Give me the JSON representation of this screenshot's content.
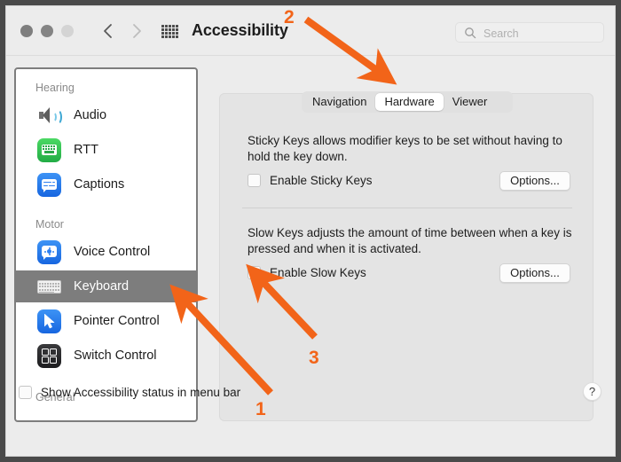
{
  "window": {
    "title": "Accessibility",
    "traffic_lights": [
      "close",
      "minimize",
      "zoom"
    ],
    "nav_back_label": "Back",
    "nav_forward_label": "Forward",
    "grid_label": "Show All"
  },
  "search": {
    "placeholder": "Search",
    "value": ""
  },
  "sidebar": {
    "groups": [
      {
        "label": "Hearing"
      },
      {
        "label": "Motor"
      },
      {
        "label": "General"
      }
    ],
    "items": [
      {
        "label": "Audio",
        "icon": "audio-icon",
        "selected": false
      },
      {
        "label": "RTT",
        "icon": "rtt-icon",
        "selected": false
      },
      {
        "label": "Captions",
        "icon": "captions-icon",
        "selected": false
      },
      {
        "label": "Voice Control",
        "icon": "voice-control-icon",
        "selected": false
      },
      {
        "label": "Keyboard",
        "icon": "keyboard-icon",
        "selected": true
      },
      {
        "label": "Pointer Control",
        "icon": "pointer-control-icon",
        "selected": false
      },
      {
        "label": "Switch Control",
        "icon": "switch-control-icon",
        "selected": false
      }
    ]
  },
  "main": {
    "tabs": [
      {
        "label": "Navigation",
        "active": false
      },
      {
        "label": "Hardware",
        "active": true
      },
      {
        "label": "Viewer",
        "active": false
      }
    ],
    "sections": [
      {
        "description": "Sticky Keys allows modifier keys to be set without having to hold the key down.",
        "checkbox_label": "Enable Sticky Keys",
        "checked": false,
        "options_label": "Options..."
      },
      {
        "description": "Slow Keys adjusts the amount of time between when a key is pressed and when it is activated.",
        "checkbox_label": "Enable Slow Keys",
        "checked": false,
        "options_label": "Options..."
      }
    ]
  },
  "footer": {
    "checkbox_label": "Show Accessibility status in menu bar",
    "checked": false,
    "help_label": "?"
  },
  "annotations": {
    "accent_color": "#f26419",
    "markers": [
      {
        "number": "1",
        "target": "sidebar-item-keyboard"
      },
      {
        "number": "2",
        "target": "tab-hardware"
      },
      {
        "number": "3",
        "target": "enable-slow-keys-checkbox"
      }
    ]
  },
  "colors": {
    "window_bg": "#ececec",
    "panel_bg": "#e4e4e4",
    "sidebar_bg": "#ffffff",
    "selected_row": "#7d7d7d",
    "accent": "#f26419"
  }
}
